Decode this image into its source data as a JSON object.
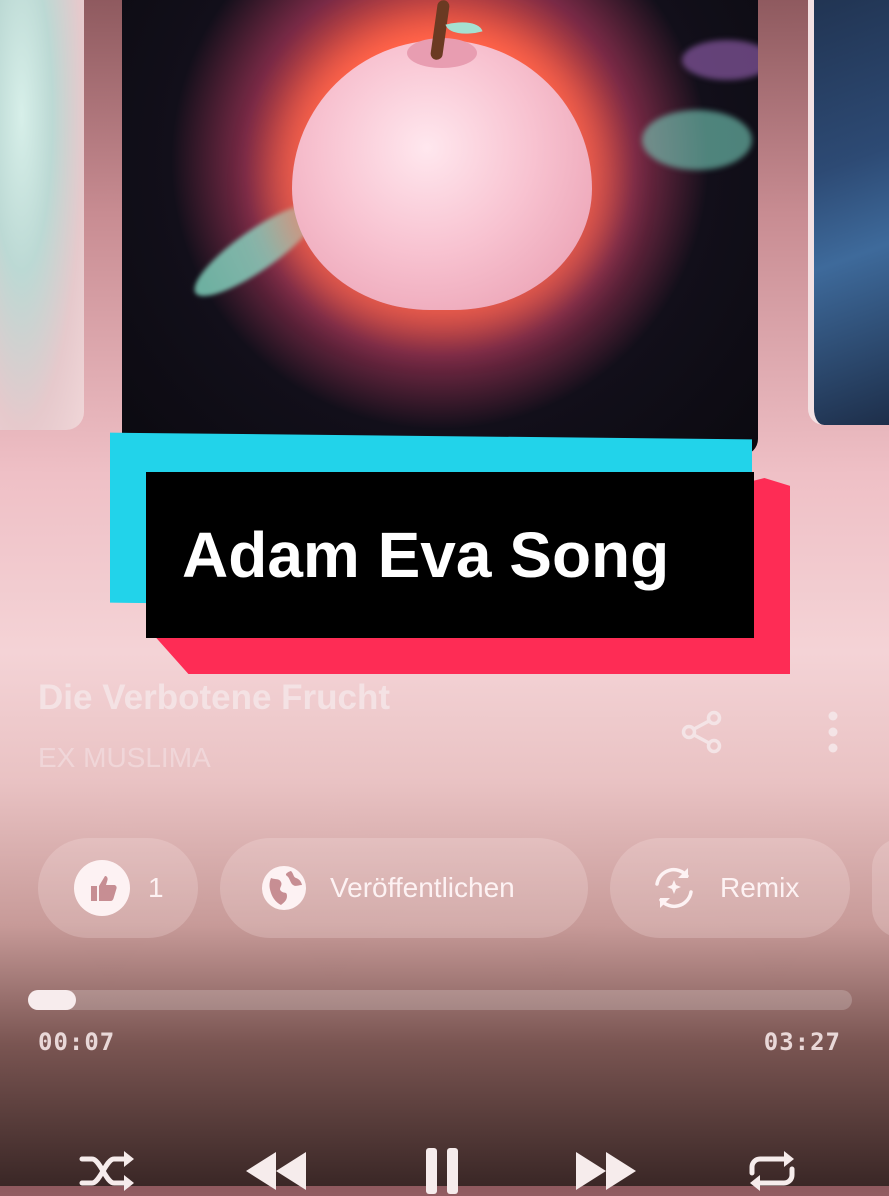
{
  "overlay": {
    "title": "Adam Eva Song"
  },
  "song": {
    "title": "Die Verbotene Frucht",
    "artist": "EX MUSLIMA"
  },
  "actions": {
    "like_count": "1",
    "publish_label": "Veröffentlichen",
    "remix_label": "Remix"
  },
  "player": {
    "current_time": "00:07",
    "total_time": "03:27",
    "progress_fraction": 0.034,
    "controls": [
      "shuffle-icon",
      "previous-icon",
      "pause-icon",
      "next-icon",
      "repeat-icon"
    ]
  },
  "colors": {
    "banner_cyan": "#22d3ea",
    "banner_red": "#fe2c55",
    "banner_black": "#000000"
  }
}
